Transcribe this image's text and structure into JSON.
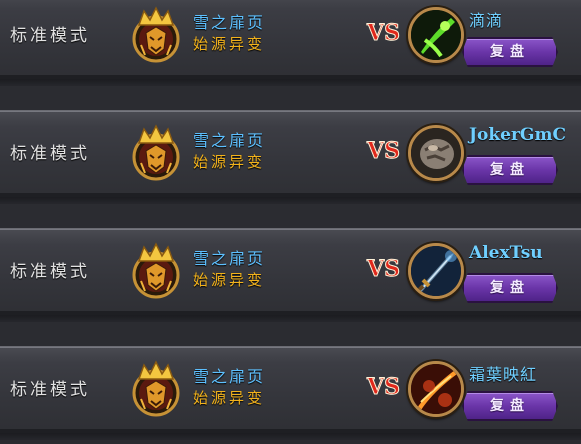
{
  "matches": [
    {
      "mode": "标准模式",
      "player_name": "雪之扉页",
      "player_class": "始源异变",
      "vs": "VS",
      "opponent_name": "滴滴",
      "opponent_avatar": "green-poison-dagger-icon",
      "replay_label": "复盘"
    },
    {
      "mode": "标准模式",
      "player_name": "雪之扉页",
      "player_class": "始源异变",
      "vs": "VS",
      "opponent_name": "JokerGmC",
      "opponent_avatar": "rock-fist-icon",
      "replay_label": "复盘"
    },
    {
      "mode": "标准模式",
      "player_name": "雪之扉页",
      "player_class": "始源异变",
      "vs": "VS",
      "opponent_name": "AlexTsu",
      "opponent_avatar": "sword-icon",
      "replay_label": "复盘"
    },
    {
      "mode": "标准模式",
      "player_name": "雪之扉页",
      "player_class": "始源异变",
      "vs": "VS",
      "opponent_name": "霜葉映紅",
      "opponent_avatar": "fire-slash-icon",
      "replay_label": "复盘"
    }
  ],
  "colors": {
    "player_name": "#5dc0ff",
    "player_class": "#f2b21c",
    "opponent_name": "#6fcfff",
    "vs_red": "#e0281c",
    "replay_button": "#6a35a8"
  }
}
